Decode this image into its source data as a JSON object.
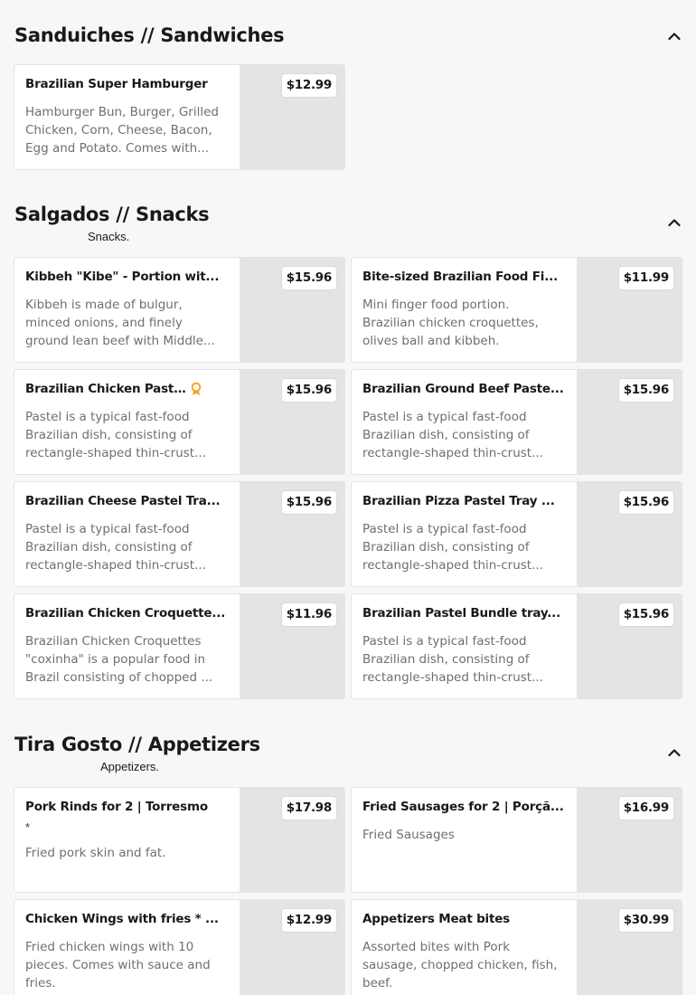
{
  "sections": {
    "sandwiches": {
      "title": "Sanduiches // Sandwiches",
      "items": [
        {
          "name": "Brazilian Super Hamburger",
          "desc": "Hamburger Bun, Burger, Grilled Chicken, Corn, Cheese, Bacon, Egg and Potato. Comes with...",
          "price": "$12.99"
        }
      ]
    },
    "snacks": {
      "title": "Salgados // Snacks",
      "subtitle": "Snacks.",
      "items": [
        {
          "name": "Kibbeh \"Kibe\" - Portion wit...",
          "desc": "Kibbeh is made of bulgur, minced onions, and finely ground lean beef with Middle...",
          "price": "$15.96"
        },
        {
          "name": "Bite-sized Brazilian Food Fi...",
          "desc": "Mini finger food portion. Brazilian chicken croquettes, olives ball and kibbeh.",
          "price": "$11.99"
        },
        {
          "name": "Brazilian Chicken Pastel ...",
          "desc": "Pastel is a typical fast-food Brazilian dish, consisting of rectangle-shaped thin-crust...",
          "price": "$15.96",
          "badge": "award-icon"
        },
        {
          "name": "Brazilian Ground Beef Paste...",
          "desc": "Pastel is a typical fast-food Brazilian dish, consisting of rectangle-shaped thin-crust...",
          "price": "$15.96"
        },
        {
          "name": "Brazilian Cheese Pastel Tra...",
          "desc": "Pastel is a typical fast-food Brazilian dish, consisting of rectangle-shaped thin-crust...",
          "price": "$15.96"
        },
        {
          "name": "Brazilian Pizza Pastel Tray ...",
          "desc": "Pastel is a typical fast-food Brazilian dish, consisting of rectangle-shaped thin-crust...",
          "price": "$15.96"
        },
        {
          "name": "Brazilian Chicken Croquette...",
          "desc": "Brazilian Chicken Croquettes \"coxinha\" is a popular food in Brazil consisting of chopped ...",
          "price": "$11.96"
        },
        {
          "name": "Brazilian Pastel Bundle tray...",
          "desc": "Pastel is a typical fast-food Brazilian dish, consisting of rectangle-shaped thin-crust...",
          "price": "$15.96"
        }
      ]
    },
    "appetizers": {
      "title": "Tira Gosto // Appetizers",
      "subtitle": "Appetizers.",
      "items": [
        {
          "name": "Pork Rinds for 2 | Torresmo",
          "note": "*",
          "desc": "Fried pork skin and fat.",
          "price": "$17.98"
        },
        {
          "name": "Fried Sausages for 2 | Porçã...",
          "desc": "Fried Sausages",
          "price": "$16.99"
        },
        {
          "name": "Chicken Wings with fries * ...",
          "desc": "Fried chicken wings with 10 pieces. Comes with sauce and fries.",
          "price": "$12.99"
        },
        {
          "name": "Appetizers Meat bites",
          "desc": "Assorted bites with Pork sausage, chopped chicken, fish, beef.",
          "price": "$30.99"
        }
      ]
    }
  },
  "icons": {
    "collapse": "chevron-up-icon",
    "badge": "award-icon"
  },
  "colors": {
    "badge": "#f5a623",
    "price_bg": "#ffffff",
    "image_placeholder": "#e4e4e6"
  }
}
